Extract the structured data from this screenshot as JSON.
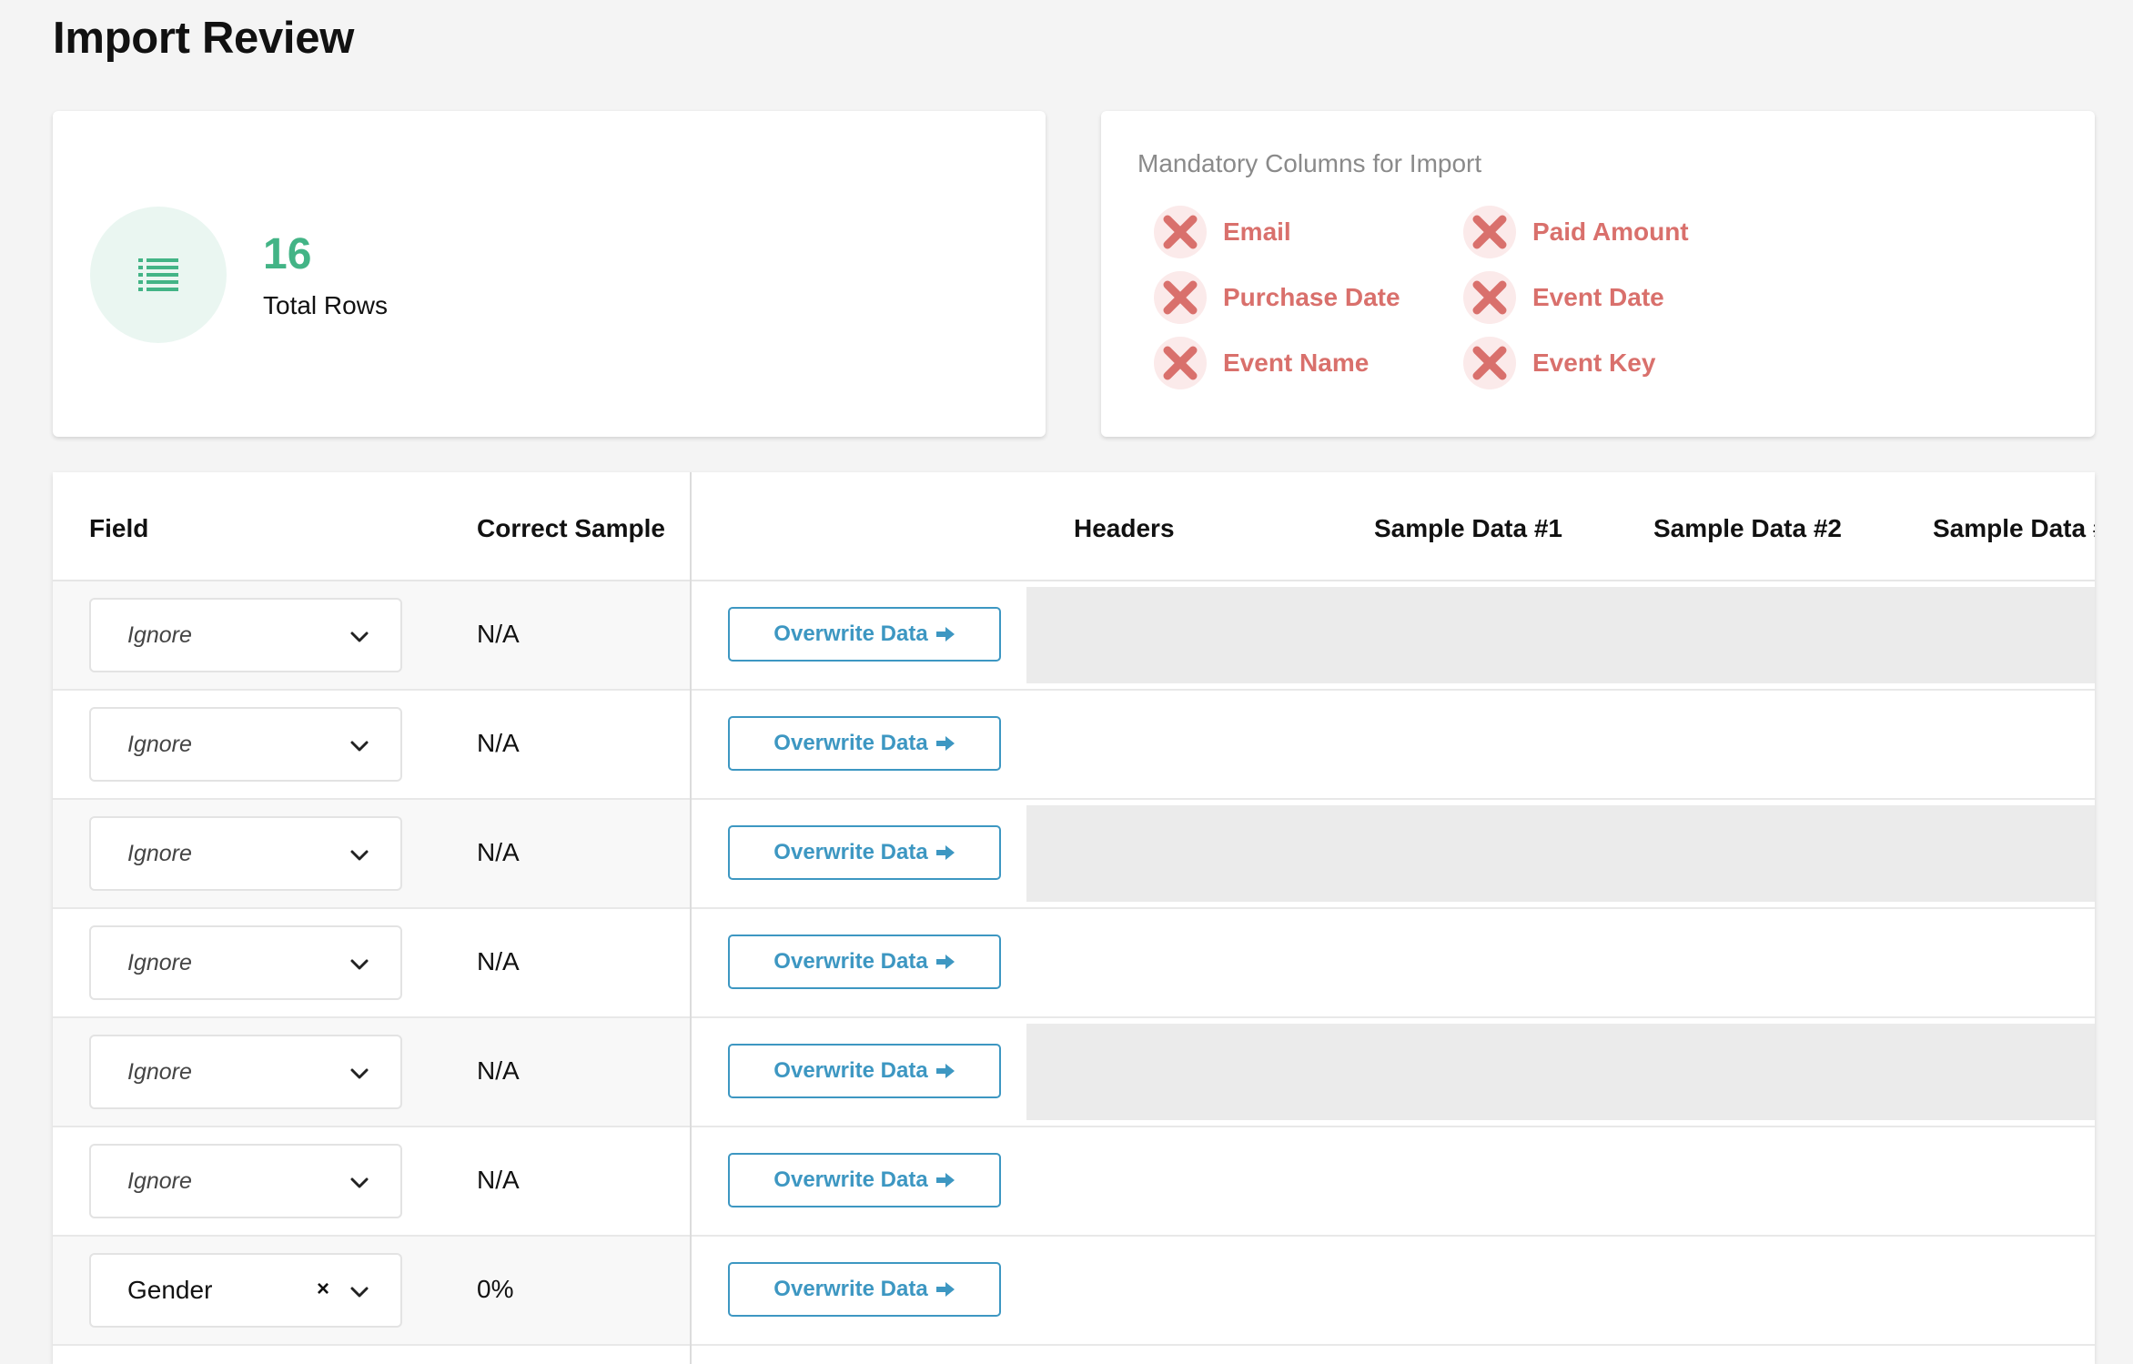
{
  "page_title": "Import Review",
  "summary": {
    "count": "16",
    "label": "Total Rows",
    "icon": "list-icon",
    "accent_color": "#43b486"
  },
  "mandatory": {
    "title": "Mandatory Columns for Import",
    "icon": "x-icon",
    "color": "#d9706c",
    "items": [
      {
        "label": "Email"
      },
      {
        "label": "Paid Amount"
      },
      {
        "label": "Purchase Date"
      },
      {
        "label": "Event Date"
      },
      {
        "label": "Event Name"
      },
      {
        "label": "Event Key"
      }
    ]
  },
  "table": {
    "headers": {
      "field": "Field",
      "correct_sample": "Correct Sample",
      "headers": "Headers",
      "sample1": "Sample Data #1",
      "sample2": "Sample Data #2",
      "sample3": "Sample Data #"
    },
    "overwrite_label": "Overwrite Data",
    "rows": [
      {
        "field": "Ignore",
        "sample": "N/A"
      },
      {
        "field": "Ignore",
        "sample": "N/A"
      },
      {
        "field": "Ignore",
        "sample": "N/A"
      },
      {
        "field": "Ignore",
        "sample": "N/A"
      },
      {
        "field": "Ignore",
        "sample": "N/A"
      },
      {
        "field": "Ignore",
        "sample": "N/A"
      },
      {
        "field": "Gender",
        "sample": "0%"
      }
    ]
  }
}
